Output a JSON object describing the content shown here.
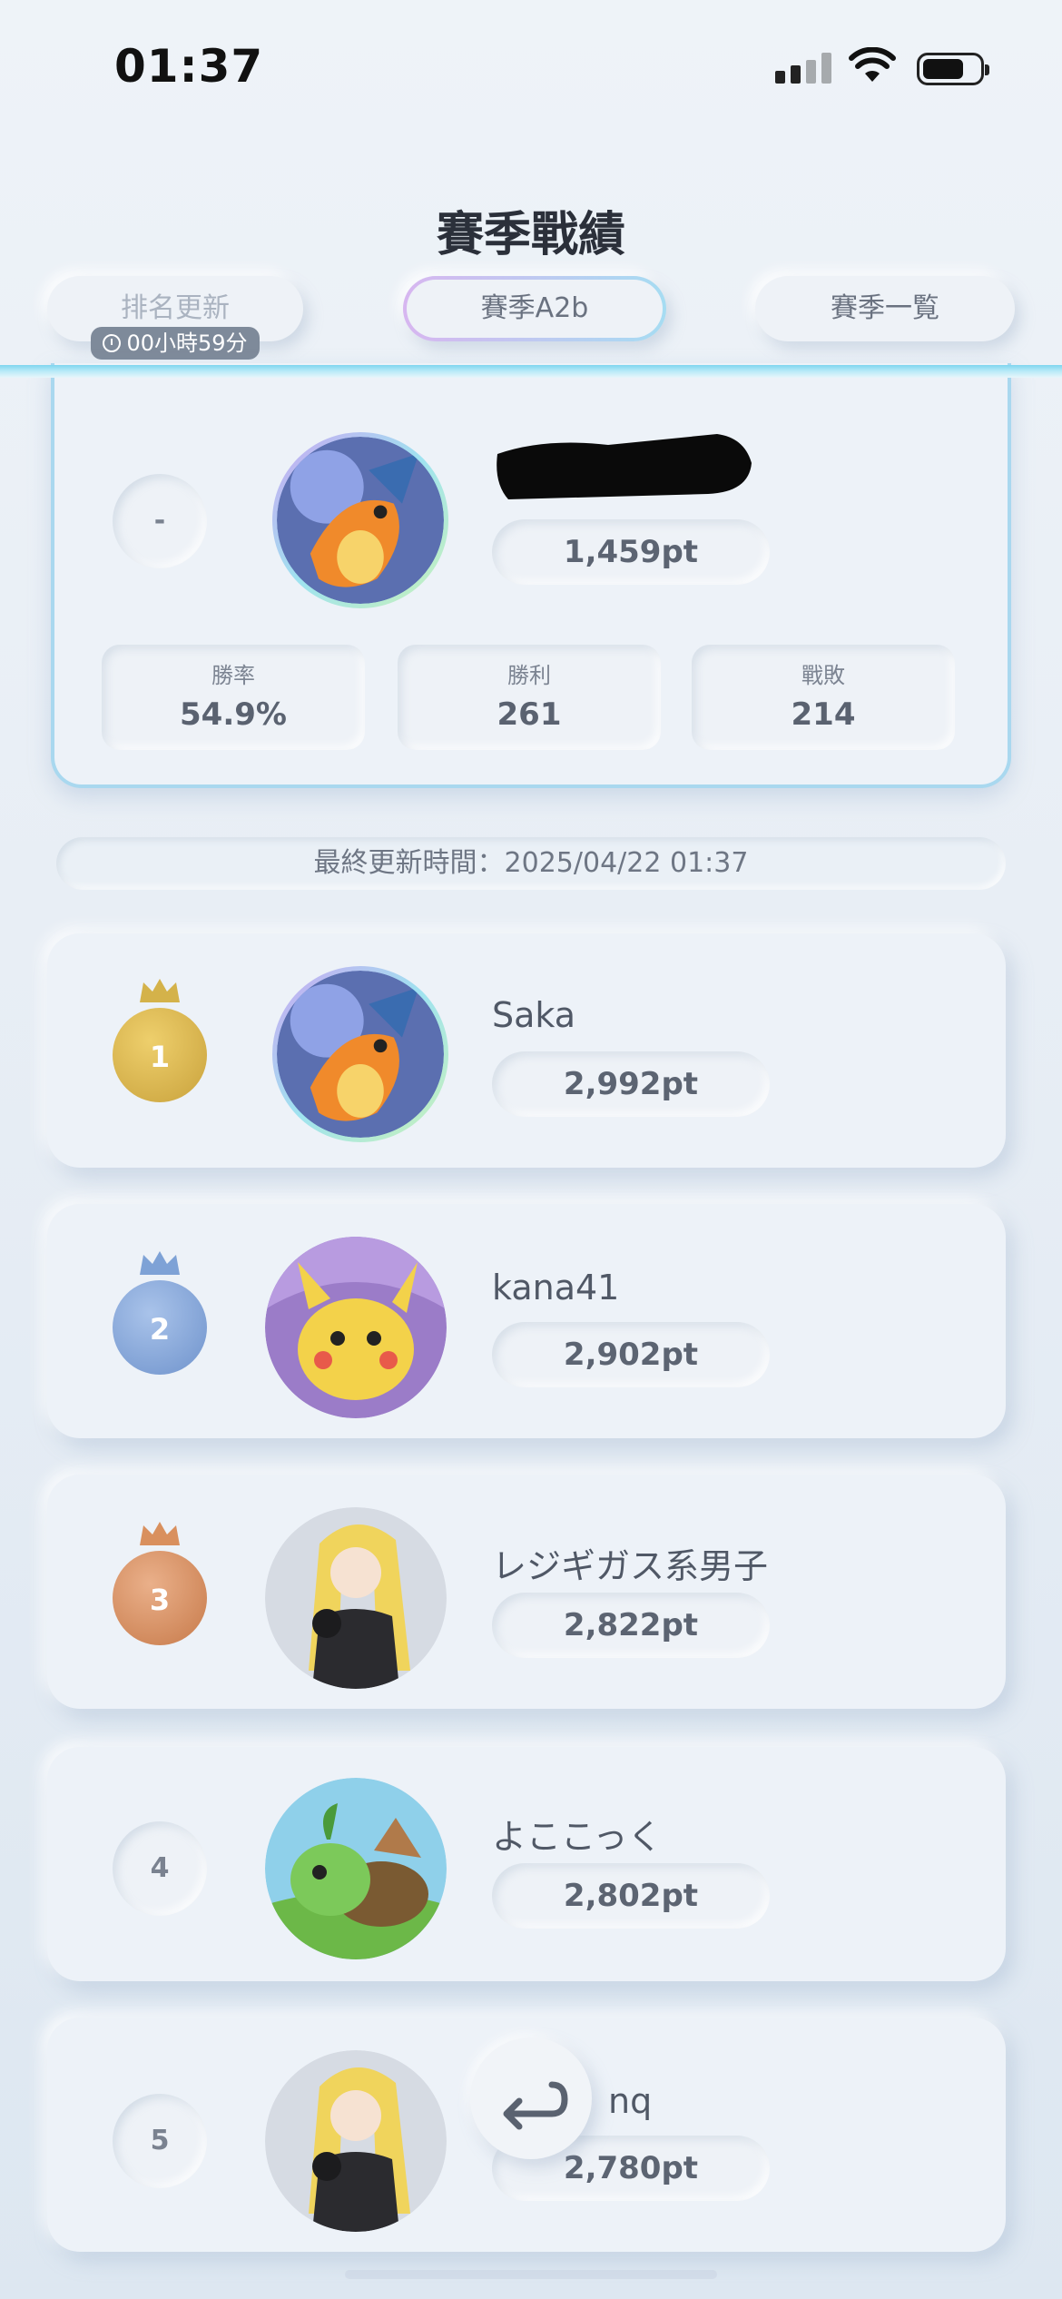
{
  "status_bar": {
    "time": "01:37"
  },
  "header": {
    "title": "賽季戰績",
    "rank_update_label": "排名更新",
    "timer": "00小時59分",
    "season_label": "賽季A2b",
    "season_list_label": "賽季一覧"
  },
  "my_card": {
    "rank": "-",
    "points": "1,459pt",
    "stats": [
      {
        "label": "勝率",
        "value": "54.9%"
      },
      {
        "label": "勝利",
        "value": "261"
      },
      {
        "label": "戰敗",
        "value": "214"
      }
    ]
  },
  "last_updated": "最終更新時間：2025/04/22 01:37",
  "rankings": [
    {
      "rank": "1",
      "name": "Saka",
      "points": "2,992pt",
      "medal_color": "#d4b24a"
    },
    {
      "rank": "2",
      "name": "kana41",
      "points": "2,902pt",
      "medal_color": "#7ea2d6"
    },
    {
      "rank": "3",
      "name": "レジギガス系男子",
      "points": "2,822pt",
      "medal_color": "#d9905e"
    },
    {
      "rank": "4",
      "name": "よここっく",
      "points": "2,802pt"
    },
    {
      "rank": "5",
      "name": "nq",
      "points": "2,780pt"
    }
  ],
  "icons": [
    "cellular-signal-icon",
    "wifi-icon",
    "battery-icon",
    "clock-icon",
    "crown-icon",
    "return-arrow-icon"
  ],
  "colors": {
    "accent": "#a9d8ef",
    "gold": "#d4b24a",
    "silver": "#7ea2d6",
    "bronze": "#d9905e"
  }
}
